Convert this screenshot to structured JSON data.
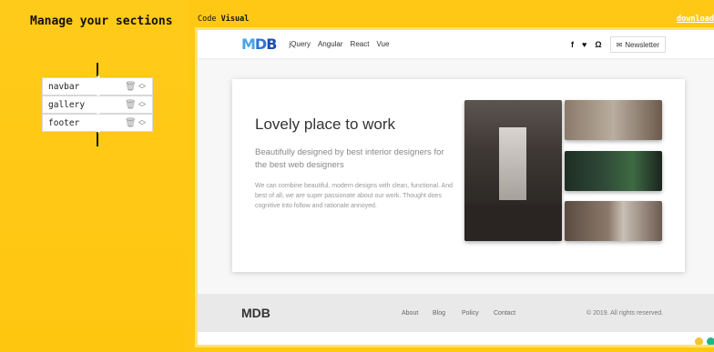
{
  "left": {
    "title": "Manage your sections",
    "sections": [
      {
        "name": "navbar"
      },
      {
        "name": "gallery"
      },
      {
        "name": "footer"
      }
    ]
  },
  "tabs": {
    "code": "Code",
    "visual": "Visual",
    "download": "download"
  },
  "preview": {
    "logo": {
      "m": "M",
      "d": "D",
      "b": "B"
    },
    "nav_links": [
      "jQuery",
      "Angular",
      "React",
      "Vue"
    ],
    "social": {
      "facebook": "f",
      "twitter": "♥",
      "github": "Ω"
    },
    "newsletter": "Newsletter",
    "card": {
      "title": "Lovely place to work",
      "subtitle": "Beautifully designed by best interior designers for the best web designers",
      "paragraph": "We can combine beautiful, modern designs with clean, functional. And best of all, we are super passionate about our work. Thought does cognitive into follow and rationale annoyed."
    },
    "footer": {
      "brand": "MDB",
      "links": [
        "About",
        "Blog",
        "Policy",
        "Contact"
      ],
      "copyright": "© 2019. All rights reserved."
    }
  }
}
